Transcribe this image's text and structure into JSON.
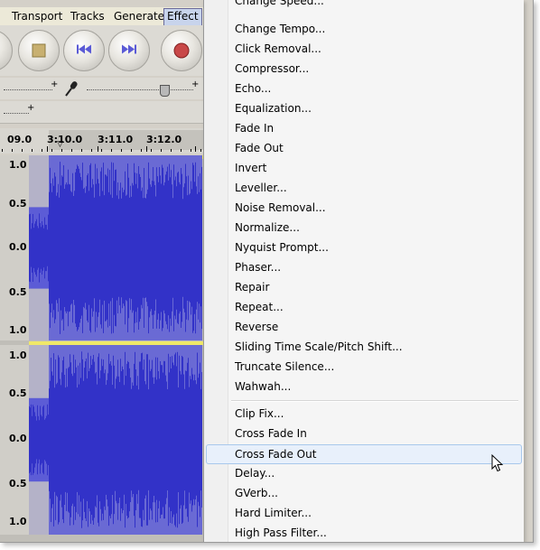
{
  "menubar": {
    "items": [
      "Transport",
      "Tracks",
      "Generate",
      "Effect"
    ],
    "active": "Effect"
  },
  "toolbar": {
    "buttons": [
      "stop-square",
      "skip-to-start-icon",
      "skip-to-end-icon",
      "record-icon"
    ],
    "plus": "+",
    "slider_level": 0.72
  },
  "ruler": {
    "labels": [
      "09.0",
      "3:10.0",
      "3:11.0",
      "3:12.0"
    ]
  },
  "tracks": [
    {
      "amplitude_labels": [
        "1.0",
        "0.5",
        "0.0",
        "0.5",
        "1.0"
      ]
    },
    {
      "amplitude_labels": [
        "1.0",
        "0.5",
        "0.0",
        "0.5",
        "1.0"
      ]
    }
  ],
  "effect_menu": {
    "items_top": [
      "Change Speed...",
      "Change Tempo...",
      "Click Removal...",
      "Compressor...",
      "Echo...",
      "Equalization...",
      "Fade In",
      "Fade Out",
      "Invert",
      "Leveller...",
      "Noise Removal...",
      "Normalize...",
      "Nyquist Prompt...",
      "Phaser...",
      "Repair",
      "Repeat...",
      "Reverse",
      "Sliding Time Scale/Pitch Shift...",
      "Truncate Silence...",
      "Wahwah..."
    ],
    "items_bottom": [
      "Clip Fix...",
      "Cross Fade In",
      "Cross Fade Out",
      "Delay...",
      "GVerb...",
      "Hard Limiter...",
      "High Pass Filter..."
    ],
    "hovered": "Cross Fade Out"
  },
  "colors": {
    "waveform": "#3232c8",
    "waveform_bg": "#6a6ad4",
    "menu_hover": "#e8f0fb"
  }
}
